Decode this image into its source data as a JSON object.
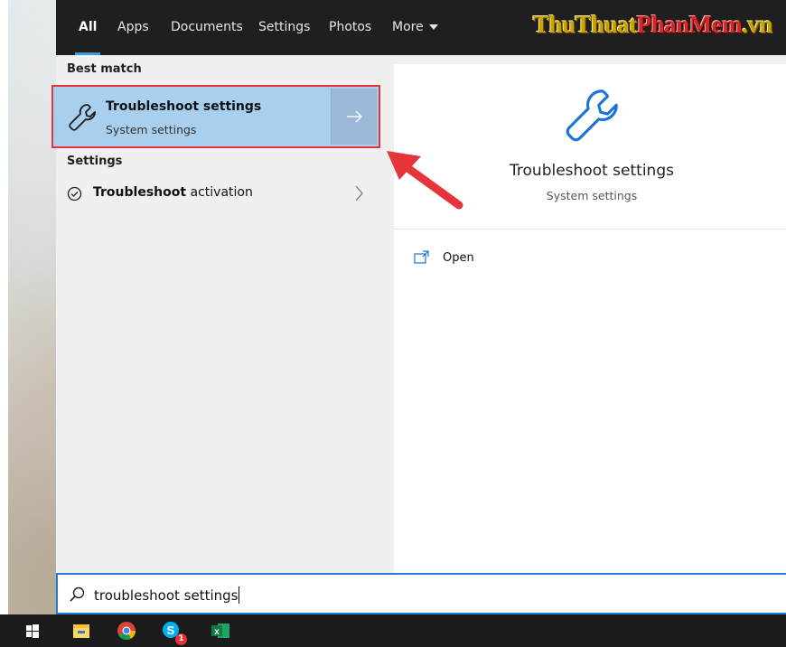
{
  "tabs": [
    {
      "label": "All",
      "active": true
    },
    {
      "label": "Apps",
      "active": false
    },
    {
      "label": "Documents",
      "active": false
    },
    {
      "label": "Settings",
      "active": false
    },
    {
      "label": "Photos",
      "active": false
    },
    {
      "label": "More",
      "active": false,
      "icon": "caret-down-icon"
    }
  ],
  "watermark": {
    "part1": "ThuThuat",
    "part2": "PhanMem",
    "part3": ".vn"
  },
  "results": {
    "best_match_heading": "Best match",
    "best_match": {
      "title": "Troubleshoot settings",
      "subtitle": "System settings",
      "icon": "wrench-icon",
      "arrow_icon": "arrow-right-icon"
    },
    "settings_heading": "Settings",
    "settings_items": [
      {
        "bold": "Troubleshoot",
        "rest": " activation",
        "icon": "check-circle-icon",
        "chevron": "chevron-right-icon"
      }
    ]
  },
  "preview": {
    "title": "Troubleshoot settings",
    "subtitle": "System settings",
    "icon": "wrench-icon",
    "actions": [
      {
        "label": "Open",
        "icon": "open-window-icon"
      }
    ]
  },
  "search": {
    "query": "troubleshoot settings",
    "icon": "search-icon"
  },
  "taskbar": {
    "items": [
      "windows-start-icon",
      "file-explorer-icon",
      "chrome-icon",
      "skype-icon",
      "excel-icon"
    ],
    "skype_badge": "1"
  },
  "colors": {
    "accent": "#3a96dd",
    "highlight": "#a9cfee",
    "annotation_red": "#e7343b"
  }
}
